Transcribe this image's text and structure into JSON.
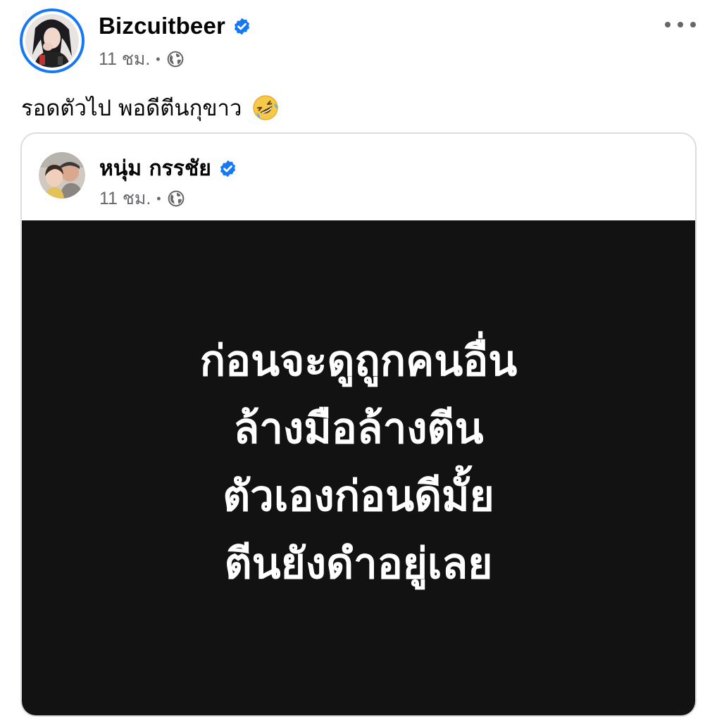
{
  "post": {
    "author": {
      "name": "Bizcuitbeer",
      "verified": true,
      "timestamp": "11 ชม.",
      "separator": "•",
      "audience_icon": "globe-icon"
    },
    "more_icon": "more-options-icon",
    "caption": "รอดตัวไป พอดีตีนกุขาว",
    "caption_emoji_icon": "rolling-on-floor-laughing-emoji-icon",
    "shared_post": {
      "author": {
        "name": "หนุ่ม กรรชัย",
        "verified": true,
        "timestamp": "11 ชม.",
        "separator": "•",
        "audience_icon": "globe-icon"
      },
      "quote_lines": [
        "ก่อนจะดูถูกคนอื่น",
        "ล้างมือล้างตีน",
        "ตัวเองก่อนดีมั้ย",
        "ตีนยังดำอยู่เลย"
      ]
    }
  },
  "colors": {
    "verified_blue": "#1877f2",
    "secondary_text": "#65676b",
    "card_border": "#dadde1",
    "quote_background": "#121212",
    "quote_text": "#ffffff"
  }
}
